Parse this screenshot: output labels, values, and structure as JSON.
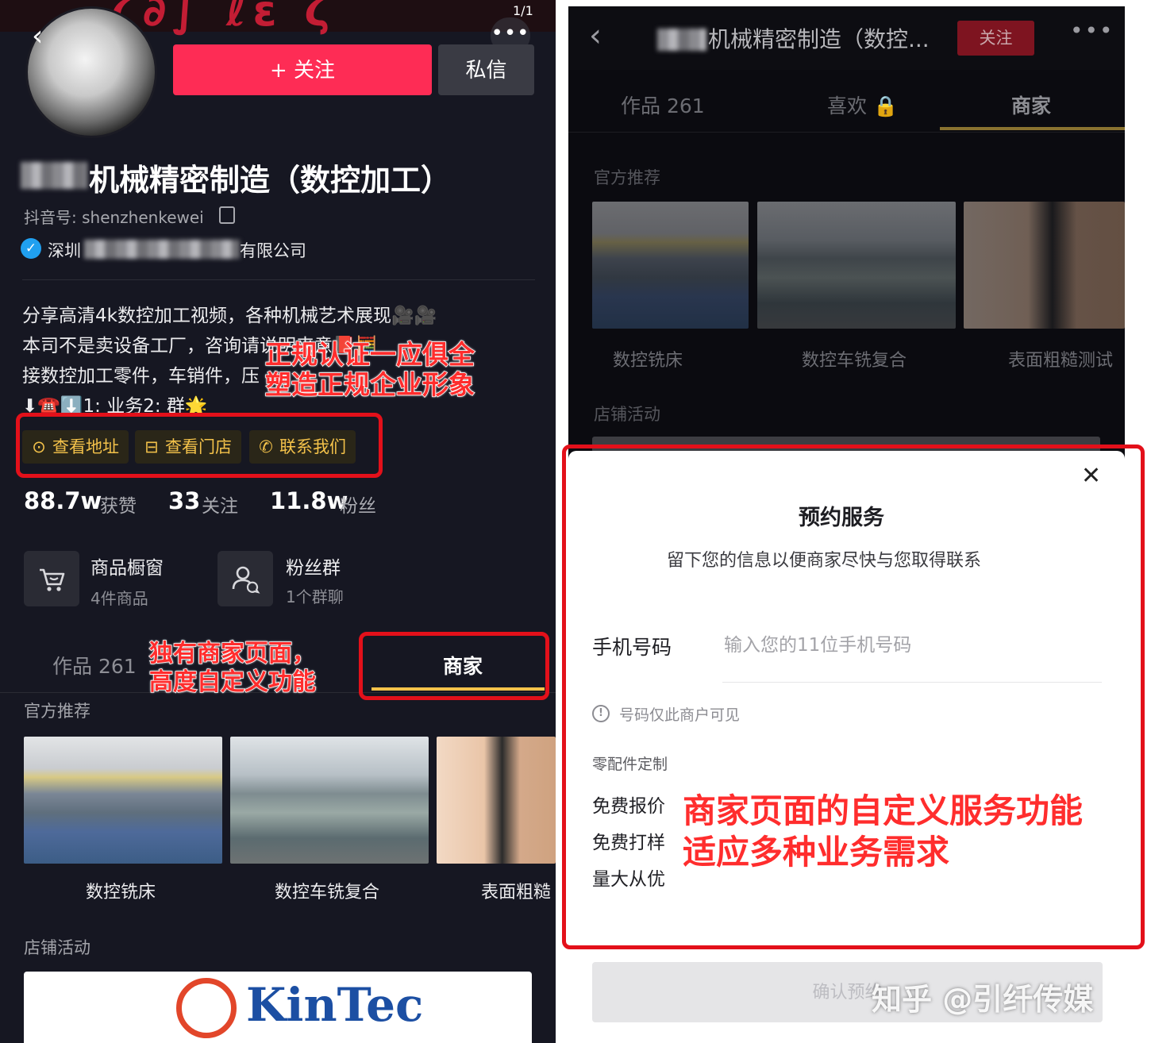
{
  "left": {
    "page_indicator": "1/1",
    "follow_label": "+ 关注",
    "message_label": "私信",
    "profile_name": "机械精密制造（数控加工）",
    "douyin_id": "抖音号: shenzhenkewei",
    "company_prefix": "深圳",
    "company_suffix": "有限公司",
    "bio": [
      "分享高清4k数控加工视频，各种机械艺术展现🎥🎥",
      "本司不是卖设备工厂，咨询请说明来意📕🧮",
      "接数控加工零件，车销件，压",
      "⬇☎️⬇️1: 业务2: 群🌟"
    ],
    "chips": [
      {
        "icon": "⊙",
        "label": "查看地址"
      },
      {
        "icon": "⊟",
        "label": "查看门店"
      },
      {
        "icon": "✆",
        "label": "联系我们"
      }
    ],
    "stats": [
      {
        "value": "88.7w",
        "label": "获赞"
      },
      {
        "value": "33",
        "label": "关注"
      },
      {
        "value": "11.8w",
        "label": "粉丝"
      }
    ],
    "entries": [
      {
        "title": "商品橱窗",
        "sub": "4件商品",
        "icon": "cart-icon"
      },
      {
        "title": "粉丝群",
        "sub": "1个群聊",
        "icon": "group-icon"
      }
    ],
    "tabs": [
      {
        "label": "作品 261"
      },
      {
        "label": "商家"
      }
    ],
    "section_recommend": "官方推荐",
    "thumbs": [
      "数控铣床",
      "数控车铣复合",
      "表面粗糙"
    ],
    "section_activity": "店铺活动",
    "logo_text": "KinTec"
  },
  "annotations": {
    "certified": [
      "正规认证一应俱全",
      "塑造正规企业形象"
    ],
    "merchant_page": [
      "独有商家页面，",
      "高度自定义功能"
    ],
    "custom_service": [
      "商家页面的自定义服务功能",
      "适应多种业务需求"
    ]
  },
  "right": {
    "title": "机械精密制造（数控...",
    "follow_label": "关注",
    "tabs": [
      {
        "label": "作品 261"
      },
      {
        "label": "喜欢 🔒"
      },
      {
        "label": "商家"
      }
    ],
    "section_recommend": "官方推荐",
    "thumbs": [
      "数控铣床",
      "数控车铣复合",
      "表面粗糙测试"
    ],
    "section_activity": "店铺活动"
  },
  "sheet": {
    "title": "预约服务",
    "subtitle": "留下您的信息以便商家尽快与您取得联系",
    "phone_label": "手机号码",
    "phone_placeholder": "输入您的11位手机号码",
    "phone_hint": "号码仅此商户可见",
    "group_title": "零配件定制",
    "options": [
      "免费报价",
      "免费打样",
      "量大从优"
    ],
    "confirm_label": "确认预约"
  },
  "watermark": "知乎 @引纤传媒",
  "colors": {
    "dark_bg": "#161722",
    "accent_pink": "#fe2c55",
    "accent_gold": "#f4c24a",
    "annotation_red": "#e3101a"
  }
}
